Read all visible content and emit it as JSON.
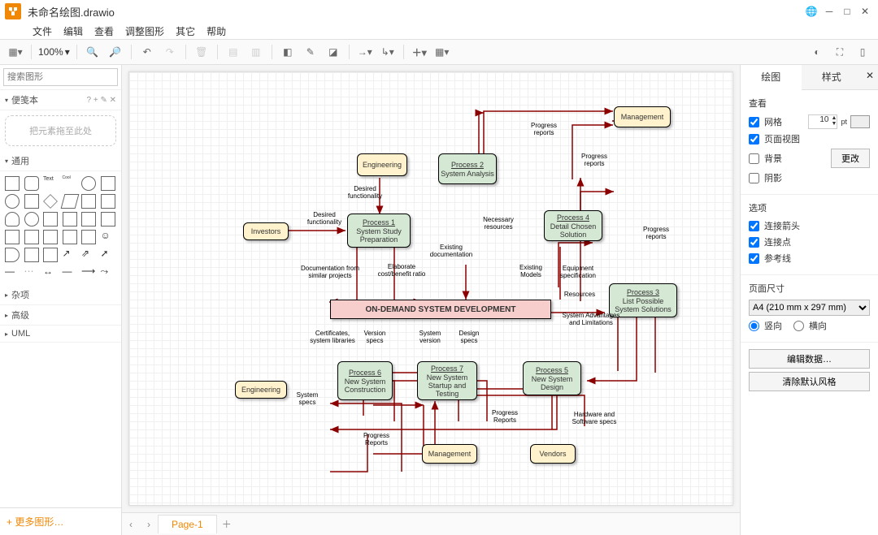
{
  "title": "未命名绘图.drawio",
  "menus": [
    "文件",
    "编辑",
    "查看",
    "调整图形",
    "其它",
    "帮助"
  ],
  "zoom": "100%",
  "search_placeholder": "搜索图形",
  "cat_scratch": "便笺本",
  "dropzone": "把元素拖至此处",
  "cat_general": "通用",
  "cat_misc": "杂项",
  "cat_advanced": "高级",
  "cat_uml": "UML",
  "more_shapes": "+ 更多图形…",
  "page_tab": "Page-1",
  "right_tabs": {
    "diagram": "绘图",
    "style": "样式"
  },
  "section_view": "查看",
  "chk_grid": "网格",
  "grid_size": "10",
  "grid_unit": "pt",
  "chk_pageview": "页面视图",
  "chk_bg": "背景",
  "btn_change": "更改",
  "chk_shadow": "阴影",
  "section_options": "选项",
  "chk_arrows": "连接箭头",
  "chk_points": "连接点",
  "chk_guides": "参考线",
  "section_pagesize": "页面尺寸",
  "page_size": "A4 (210 mm x 297 mm)",
  "radio_portrait": "竖向",
  "radio_landscape": "横向",
  "btn_editdata": "编辑数据…",
  "btn_cleardefault": "清除默认风格",
  "nodes": {
    "investors": "Investors",
    "engineering": "Engineering",
    "management": "Management",
    "vendors": "Vendors",
    "p1_h": "Process 1",
    "p1_b": "System Study Preparation",
    "p2_h": "Process 2",
    "p2_b": "System Analysis",
    "p3_h": "Process 3",
    "p3_b": "List Possible System Solutions",
    "p4_h": "Process 4",
    "p4_b": "Detail Chosen Solution",
    "p5_h": "Process 5",
    "p5_b": "New System Design",
    "p6_h": "Process 6",
    "p6_b": "New System Construction",
    "p7_h": "Process 7",
    "p7_b": "New System Startup and Testing",
    "center": "ON-DEMAND SYSTEM DEVELOPMENT"
  },
  "edges": {
    "desired": "Desired functionality",
    "desired2": "Desired functionality",
    "doc_similar": "Documentation from similar projects",
    "cost_benefit": "Elaborate cost/benefit ratio",
    "existing_doc": "Existing documentation",
    "necessary_res": "Necessary resources",
    "progress": "Progress reports",
    "progress2": "Progress reports",
    "progress3": "Progress reports",
    "progress4": "Progress Reports",
    "progress5": "Progress Reports",
    "resources": "Resources",
    "existing_models": "Existing Models",
    "equip_spec": "Equipment specification",
    "sys_adv": "System Advantages and Limitations",
    "cert": "Certificates, system libraries",
    "ver_specs": "Version specs",
    "sys_ver": "System version",
    "design_specs": "Design specs",
    "sys_specs": "System specs",
    "hw_sw": "Hardware and Software specs"
  }
}
